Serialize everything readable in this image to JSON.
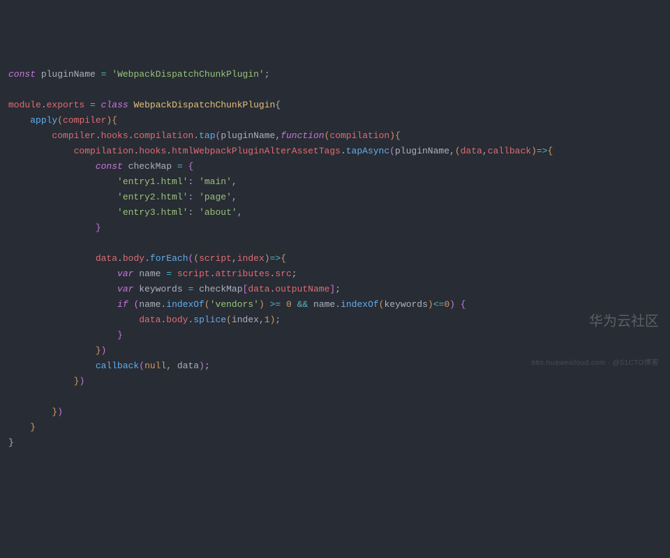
{
  "code": {
    "pluginNameVar": "pluginName",
    "pluginNameStr": "'WebpackDispatchChunkPlugin'",
    "className": "WebpackDispatchChunkPlugin",
    "apply": "apply",
    "compiler": "compiler",
    "hooks": "hooks",
    "compilation": "compilation",
    "tap": "tap",
    "function": "function",
    "htmlHook": "htmlWebpackPluginAlterAssetTags",
    "tapAsync": "tapAsync",
    "data": "data",
    "callback": "callback",
    "checkMap": "checkMap",
    "map": {
      "k1": "'entry1.html'",
      "v1": "'main'",
      "k2": "'entry2.html'",
      "v2": "'page'",
      "k3": "'entry3.html'",
      "v3": "'about'"
    },
    "body": "body",
    "forEach": "forEach",
    "script": "script",
    "index": "index",
    "name": "name",
    "attributes": "attributes",
    "src": "src",
    "keywords": "keywords",
    "outputName": "outputName",
    "indexOf": "indexOf",
    "vendors": "'vendors'",
    "zero": "0",
    "splice": "splice",
    "one": "1",
    "null": "null",
    "module": "module",
    "exports": "exports"
  },
  "kw": {
    "const": "const",
    "class": "class",
    "var": "var",
    "if": "if"
  },
  "watermark": {
    "main": "华为云社区",
    "sub": "bbs.huaweicloud.com",
    "tag": "@51CTO博客"
  }
}
